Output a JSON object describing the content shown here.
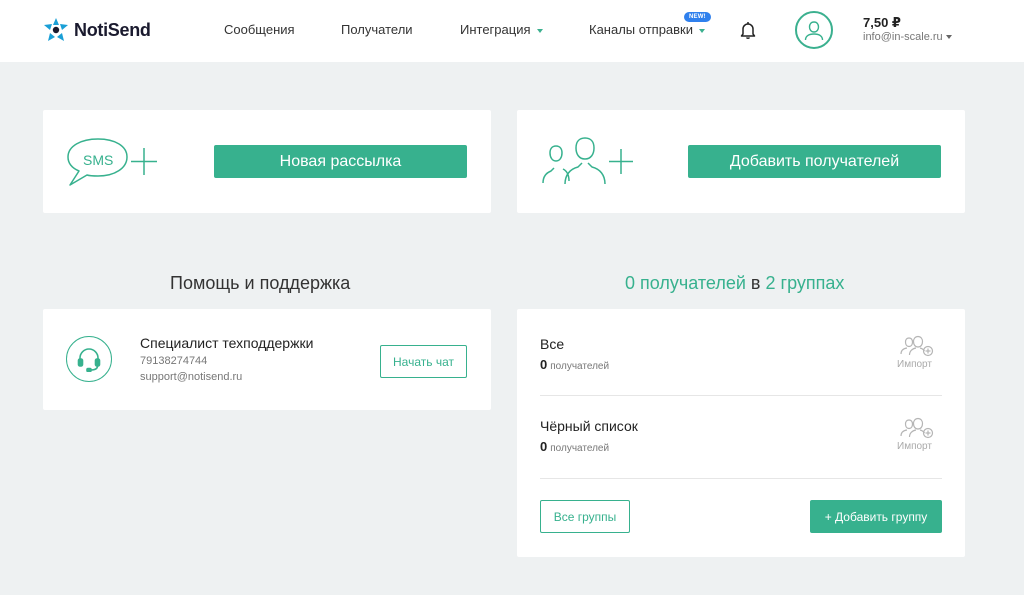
{
  "brand": {
    "name": "NotiSend"
  },
  "nav": {
    "messages": "Сообщения",
    "recipients": "Получатели",
    "integration": "Интеграция",
    "channels": "Каналы отправки",
    "new_badge": "NEW!"
  },
  "account": {
    "balance": "7,50 ₽",
    "email": "info@in-scale.ru"
  },
  "actions": {
    "sms_icon_text": "SMS",
    "new_mailing": "Новая рассылка",
    "add_recipients": "Добавить получателей"
  },
  "support": {
    "title": "Помощь и поддержка",
    "role": "Специалист техподдержки",
    "phone": "79138274744",
    "email": "support@notisend.ru",
    "chat_button": "Начать чат"
  },
  "recipients_summary": {
    "count_text": "0 получателей",
    "connector": "в",
    "groups_text": "2 группах"
  },
  "groups": [
    {
      "name": "Все",
      "count": "0",
      "unit": "получателей",
      "import_label": "Импорт"
    },
    {
      "name": "Чёрный список",
      "count": "0",
      "unit": "получателей",
      "import_label": "Импорт"
    }
  ],
  "group_actions": {
    "all_groups": "Все группы",
    "add_group": "+ Добавить группу"
  },
  "colors": {
    "accent": "#37b18e",
    "badge": "#2f80ed",
    "background": "#eef1f2"
  }
}
